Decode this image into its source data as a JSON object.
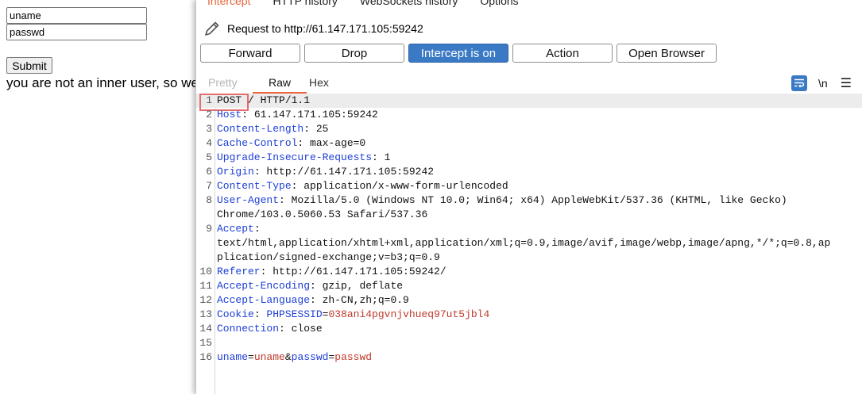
{
  "browser": {
    "uname_value": "uname",
    "passwd_value": "passwd",
    "submit_label": "Submit",
    "result_text": "you are not an inner user, so we"
  },
  "burp": {
    "top_tabs": [
      "Intercept",
      "HTTP history",
      "WebSockets history",
      "Options"
    ],
    "request_to": "Request to http://61.147.171.105:59242",
    "buttons": {
      "forward": "Forward",
      "drop": "Drop",
      "intercept": "Intercept is on",
      "action": "Action",
      "open_browser": "Open Browser"
    },
    "view_tabs": {
      "pretty": "Pretty",
      "raw": "Raw",
      "hex": "Hex"
    },
    "newline_toggle": "\\n",
    "colors": {
      "accent": "#e8633a",
      "primary": "#3a79c4",
      "header_key": "#1d3fd6",
      "param_value": "#c0392b"
    },
    "lines": [
      {
        "n": "1",
        "method": "POST",
        "rest": " / HTTP/1.1"
      },
      {
        "n": "2",
        "key": "Host",
        "val": ": 61.147.171.105:59242"
      },
      {
        "n": "3",
        "key": "Content-Length",
        "val": ": 25"
      },
      {
        "n": "4",
        "key": "Cache-Control",
        "val": ": max-age=0"
      },
      {
        "n": "5",
        "key": "Upgrade-Insecure-Requests",
        "val": ": 1"
      },
      {
        "n": "6",
        "key": "Origin",
        "val": ": http://61.147.171.105:59242"
      },
      {
        "n": "7",
        "key": "Content-Type",
        "val": ": application/x-www-form-urlencoded"
      },
      {
        "n": "8",
        "key": "User-Agent",
        "val": ": Mozilla/5.0 (Windows NT 10.0; Win64; x64) AppleWebKit/537.36 (KHTML, like Gecko)",
        "cont": "Chrome/103.0.5060.53 Safari/537.36"
      },
      {
        "n": "9",
        "key": "Accept",
        "val": ":",
        "cont": "text/html,application/xhtml+xml,application/xml;q=0.9,image/avif,image/webp,image/apng,*/*;q=0.8,ap",
        "cont2": "plication/signed-exchange;v=b3;q=0.9"
      },
      {
        "n": "10",
        "key": "Referer",
        "val": ": http://61.147.171.105:59242/"
      },
      {
        "n": "11",
        "key": "Accept-Encoding",
        "val": ": gzip, deflate"
      },
      {
        "n": "12",
        "key": "Accept-Language",
        "val": ": zh-CN,zh;q=0.9"
      },
      {
        "n": "13",
        "key": "Cookie",
        "val": ": ",
        "ckey": "PHPSESSID",
        "ceq": "=",
        "cval": "038ani4pgvnjvhueq97ut5jbl4"
      },
      {
        "n": "14",
        "key": "Connection",
        "val": ": close"
      },
      {
        "n": "15"
      },
      {
        "n": "16",
        "p1k": "uname",
        "p1v": "uname",
        "amp": "&",
        "p2k": "passwd",
        "p2v": "passwd"
      }
    ]
  }
}
